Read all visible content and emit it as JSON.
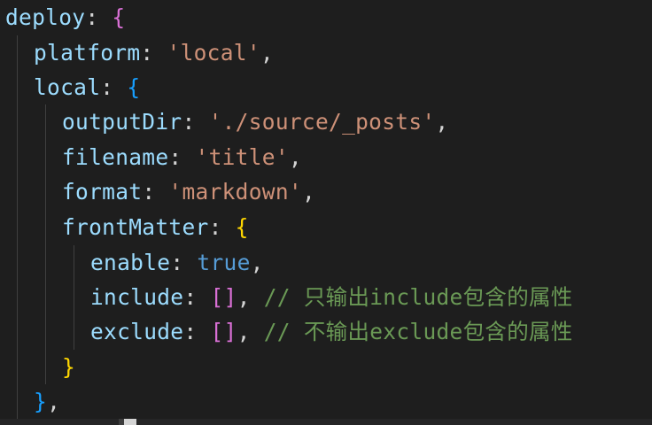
{
  "code": {
    "l1": {
      "key": "deploy",
      "colon": ": ",
      "open": "{"
    },
    "l2": {
      "key": "platform",
      "colon": ": ",
      "value": "'local'",
      "comma": ","
    },
    "l3": {
      "key": "local",
      "colon": ": ",
      "open": "{"
    },
    "l4": {
      "key": "outputDir",
      "colon": ": ",
      "value": "'./source/_posts'",
      "comma": ","
    },
    "l5": {
      "key": "filename",
      "colon": ": ",
      "value": "'title'",
      "comma": ","
    },
    "l6": {
      "key": "format",
      "colon": ": ",
      "value": "'markdown'",
      "comma": ","
    },
    "l7": {
      "key": "frontMatter",
      "colon": ": ",
      "open": "{"
    },
    "l8": {
      "key": "enable",
      "colon": ": ",
      "value": "true",
      "comma": ","
    },
    "l9": {
      "key": "include",
      "colon": ": ",
      "brackets": "[]",
      "comma": ", ",
      "comment": "// 只输出include包含的属性"
    },
    "l10": {
      "key": "exclude",
      "colon": ": ",
      "brackets": "[]",
      "comma": ", ",
      "comment": "// 不输出exclude包含的属性"
    },
    "l11": {
      "close": "}"
    },
    "l12": {
      "close": "}",
      "comma": ","
    }
  },
  "colors": {
    "background": "#1e1e1e",
    "property": "#9cdcfe",
    "string": "#ce9178",
    "keyword": "#569cd6",
    "comment": "#6a9955",
    "bracket_level1": "#ffd700",
    "bracket_level2": "#da70d6",
    "bracket_level3": "#179fff"
  }
}
